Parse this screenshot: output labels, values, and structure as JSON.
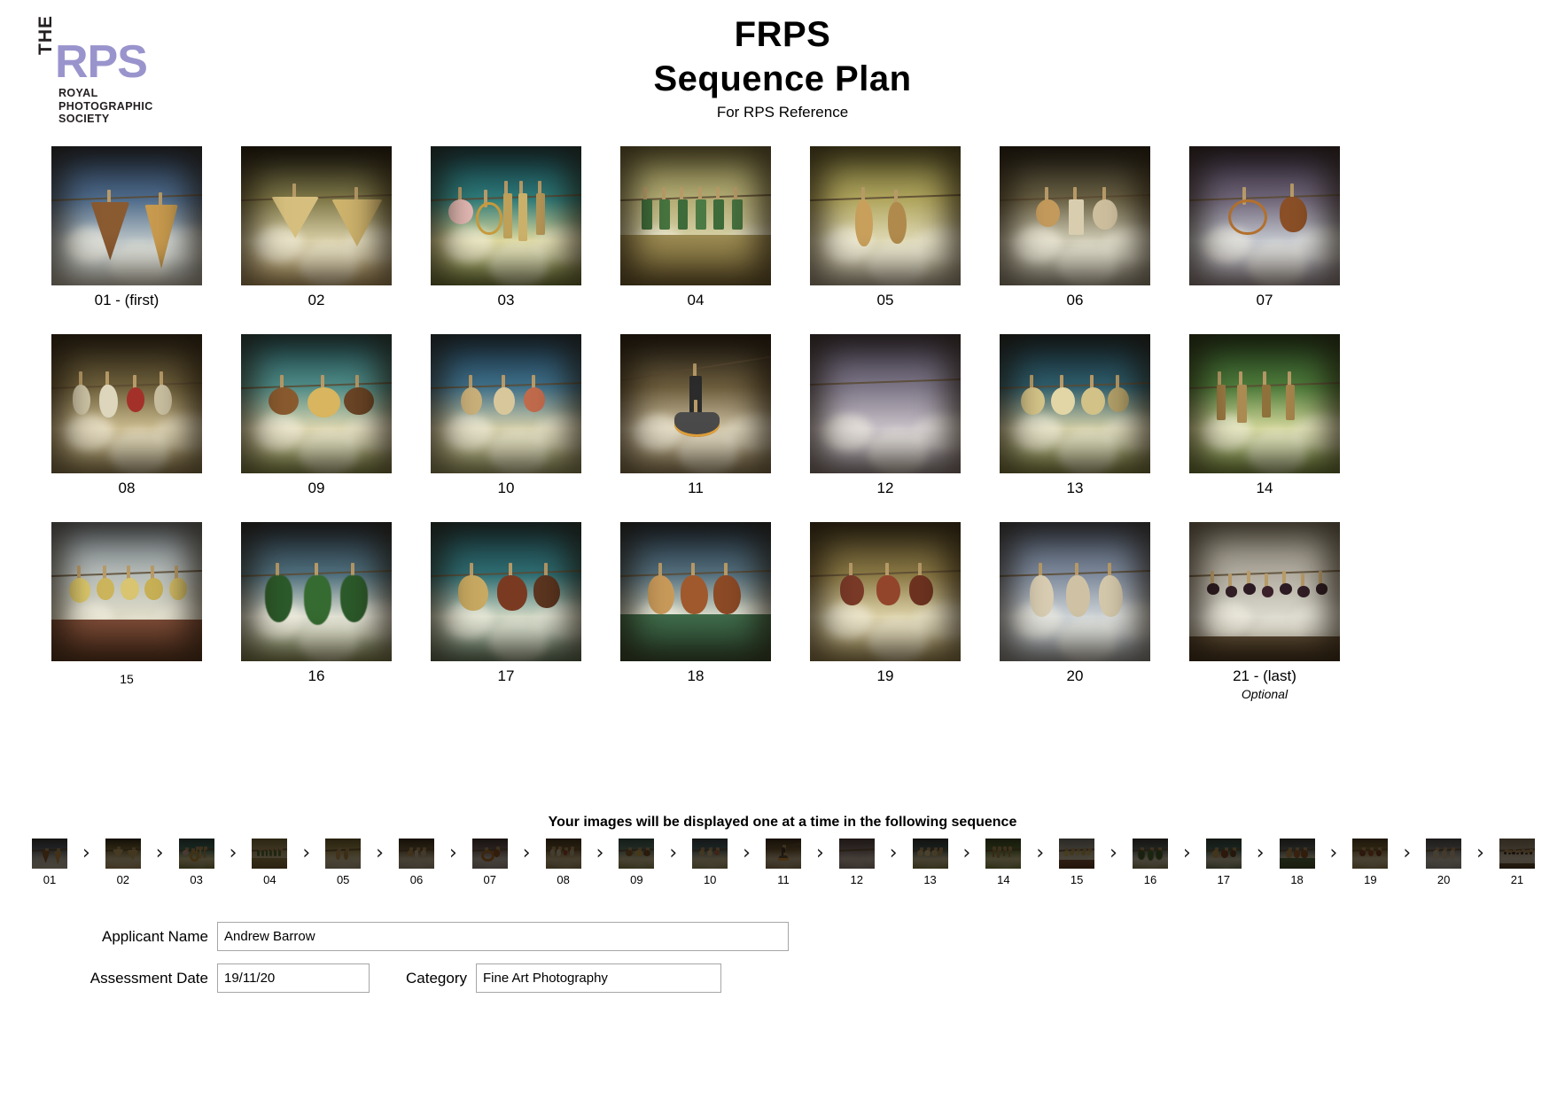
{
  "logo": {
    "the": "THE",
    "rps": "RPS",
    "line1": "ROYAL",
    "line2": "PHOTOGRAPHIC",
    "line3": "SOCIETY",
    "accent_color": "#9a94cd"
  },
  "header": {
    "title": "FRPS",
    "subtitle": "Sequence Plan",
    "note": "For RPS Reference"
  },
  "grid": {
    "rows": [
      [
        {
          "label": "01 - (first)",
          "sub": ""
        },
        {
          "label": "02",
          "sub": ""
        },
        {
          "label": "03",
          "sub": ""
        },
        {
          "label": "04",
          "sub": ""
        },
        {
          "label": "05",
          "sub": ""
        },
        {
          "label": "06",
          "sub": ""
        },
        {
          "label": "07",
          "sub": ""
        }
      ],
      [
        {
          "label": "08",
          "sub": ""
        },
        {
          "label": "09",
          "sub": ""
        },
        {
          "label": "10",
          "sub": ""
        },
        {
          "label": "11",
          "sub": ""
        },
        {
          "label": "12",
          "sub": ""
        },
        {
          "label": "13",
          "sub": ""
        },
        {
          "label": "14",
          "sub": ""
        }
      ],
      [
        {
          "label": "15",
          "sub": ""
        },
        {
          "label": "16",
          "sub": ""
        },
        {
          "label": "17",
          "sub": ""
        },
        {
          "label": "18",
          "sub": ""
        },
        {
          "label": "19",
          "sub": ""
        },
        {
          "label": "20",
          "sub": ""
        },
        {
          "label": "21 - (last)",
          "sub": "Optional"
        }
      ]
    ]
  },
  "sequence": {
    "caption": "Your images will be displayed one at a time in the following sequence",
    "arrow": "›",
    "numbers": [
      "01",
      "02",
      "03",
      "04",
      "05",
      "06",
      "07",
      "08",
      "09",
      "10",
      "11",
      "12",
      "13",
      "14",
      "15",
      "16",
      "17",
      "18",
      "19",
      "20",
      "21"
    ]
  },
  "form": {
    "applicant_label": "Applicant Name",
    "applicant_value": "Andrew Barrow",
    "date_label": "Assessment Date",
    "date_value": "19/11/20",
    "category_label": "Category",
    "category_value": "Fine Art Photography"
  }
}
